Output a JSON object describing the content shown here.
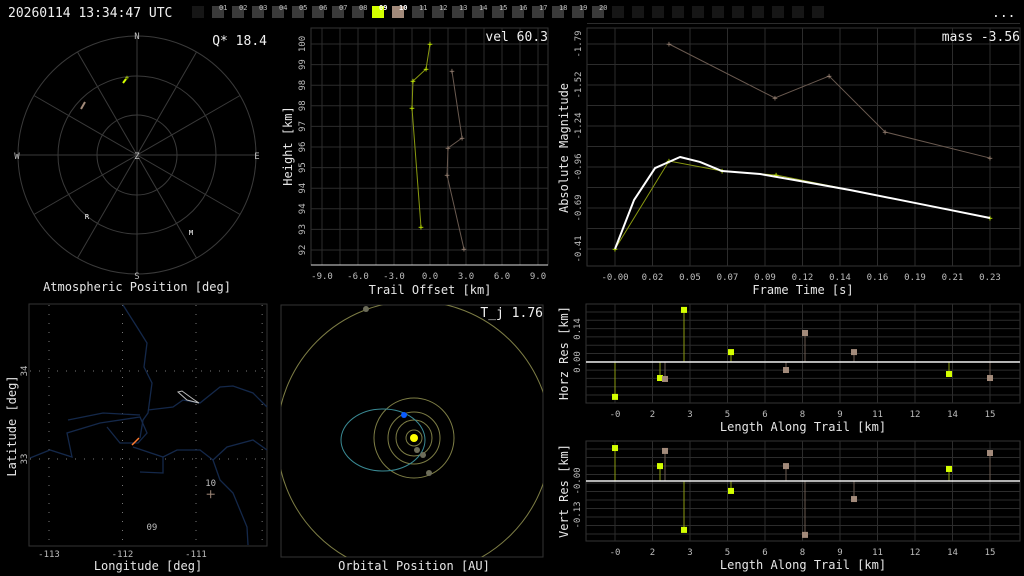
{
  "header": {
    "timestamp": "20260114 13:34:47 UTC",
    "menu_label": "...",
    "frames": [
      {
        "label": "01",
        "state": "normal"
      },
      {
        "label": "02",
        "state": "normal"
      },
      {
        "label": "03",
        "state": "normal"
      },
      {
        "label": "04",
        "state": "normal"
      },
      {
        "label": "05",
        "state": "normal"
      },
      {
        "label": "06",
        "state": "normal"
      },
      {
        "label": "07",
        "state": "normal"
      },
      {
        "label": "08",
        "state": "normal"
      },
      {
        "label": "09",
        "state": "active"
      },
      {
        "label": "10",
        "state": "selected"
      },
      {
        "label": "11",
        "state": "normal"
      },
      {
        "label": "12",
        "state": "normal"
      },
      {
        "label": "13",
        "state": "normal"
      },
      {
        "label": "14",
        "state": "normal"
      },
      {
        "label": "15",
        "state": "normal"
      },
      {
        "label": "16",
        "state": "normal"
      },
      {
        "label": "17",
        "state": "normal"
      },
      {
        "label": "18",
        "state": "normal"
      },
      {
        "label": "19",
        "state": "normal"
      },
      {
        "label": "20",
        "state": "normal"
      }
    ]
  },
  "colors": {
    "station_a": "#d4ff00",
    "station_b": "#a28a7a",
    "fit": "#ffffff",
    "grid": "#2c2c2c",
    "river": "#14284a",
    "orbit": "#7d7d45",
    "meteoroid_orbit": "#3a8a94",
    "meteoroid": "#0a5cff",
    "sun": "#ffff00"
  },
  "atmospheric": {
    "title": "Atmospheric Position [deg]",
    "metric": "Q* 18.4",
    "cardinals": {
      "n": "N",
      "s": "S",
      "e": "E",
      "w": "W",
      "z": "Z"
    },
    "markers": [
      {
        "label": "R"
      },
      {
        "label": "M"
      }
    ]
  },
  "map": {
    "xlabel": "Longitude [deg]",
    "ylabel": "Latitude [deg]",
    "xticks": [
      {
        "value": -113,
        "label": "-113"
      },
      {
        "value": -112,
        "label": "-112"
      },
      {
        "value": -111,
        "label": "-111"
      }
    ],
    "yticks": [
      {
        "value": 34,
        "label": "34"
      },
      {
        "value": 33,
        "label": "33"
      }
    ],
    "stations": [
      {
        "label": "10",
        "lon": -110.8,
        "lat": 32.6
      },
      {
        "label": "09",
        "lon": -111.6,
        "lat": 32.1
      }
    ]
  },
  "orbital": {
    "title": "Orbital Position [AU]",
    "metric": "T_j 1.76"
  },
  "chart_data": [
    {
      "id": "trail",
      "type": "line",
      "metric": "vel 60.3",
      "xlabel": "Trail Offset [km]",
      "ylabel": "Height [km]",
      "xlim": [
        -9.8,
        9.8
      ],
      "ylim": [
        91.2,
        100.6
      ],
      "xticks": [
        {
          "v": -9,
          "l": "-9.0"
        },
        {
          "v": -6,
          "l": "-6.0"
        },
        {
          "v": -3,
          "l": "-3.0"
        },
        {
          "v": 0,
          "l": "0.0"
        },
        {
          "v": 3,
          "l": "3.0"
        },
        {
          "v": 6,
          "l": "6.0"
        },
        {
          "v": 9,
          "l": "9.0"
        }
      ],
      "yticks": [
        {
          "v": 100,
          "l": "100"
        },
        {
          "v": 99.2,
          "l": "99"
        },
        {
          "v": 98.4,
          "l": "98"
        },
        {
          "v": 97.6,
          "l": "98"
        },
        {
          "v": 96.8,
          "l": "97"
        },
        {
          "v": 96.0,
          "l": "96"
        },
        {
          "v": 95.2,
          "l": "95"
        },
        {
          "v": 94.4,
          "l": "94"
        },
        {
          "v": 93.6,
          "l": "94"
        },
        {
          "v": 92.8,
          "l": "93"
        },
        {
          "v": 92.0,
          "l": "92"
        }
      ],
      "series": [
        {
          "station": "a",
          "x": [
            0.0,
            -0.33,
            -1.42,
            -1.5,
            -0.75
          ],
          "y": [
            100.0,
            99.03,
            98.56,
            97.51,
            92.89
          ]
        },
        {
          "station": "b",
          "x": [
            1.83,
            2.67,
            1.5,
            1.42,
            2.83
          ],
          "y": [
            98.95,
            96.35,
            95.96,
            94.91,
            92.04
          ]
        }
      ]
    },
    {
      "id": "magnitude",
      "type": "line",
      "metric": "mass -3.56",
      "xlabel": "Frame Time [s]",
      "ylabel": "Absolute Magnitude",
      "xticks": [
        {
          "v": 0,
          "l": "-0.00"
        },
        {
          "v": 0.0234,
          "l": "0.02"
        },
        {
          "v": 0.0468,
          "l": "0.05"
        },
        {
          "v": 0.0702,
          "l": "0.07"
        },
        {
          "v": 0.0936,
          "l": "0.09"
        },
        {
          "v": 0.117,
          "l": "0.12"
        },
        {
          "v": 0.1404,
          "l": "0.14"
        },
        {
          "v": 0.1638,
          "l": "0.16"
        },
        {
          "v": 0.1872,
          "l": "0.19"
        },
        {
          "v": 0.2106,
          "l": "0.21"
        },
        {
          "v": 0.234,
          "l": "0.23"
        }
      ],
      "yticks": [
        {
          "v": -1.79,
          "l": "-1.79"
        },
        {
          "v": -1.515,
          "l": "-1.52"
        },
        {
          "v": -1.24,
          "l": "-1.24"
        },
        {
          "v": -0.965,
          "l": "-0.96"
        },
        {
          "v": -0.69,
          "l": "-0.69"
        },
        {
          "v": -0.415,
          "l": "-0.41"
        }
      ],
      "yinverted": true,
      "series": [
        {
          "station": "a",
          "x": [
            0.0,
            0.0337,
            0.0668,
            0.1005,
            0.234
          ],
          "y": [
            -0.415,
            -1.005,
            -0.938,
            -0.911,
            -0.623
          ]
        },
        {
          "station": "b",
          "x": [
            0.0337,
            0.0998,
            0.1336,
            0.1685,
            0.234
          ],
          "y": [
            -1.79,
            -1.428,
            -1.575,
            -1.2,
            -1.025
          ]
        },
        {
          "station": "fit",
          "x": [
            0.0,
            0.0119,
            0.025,
            0.0406,
            0.053,
            0.0668,
            0.0905,
            0.1154,
            0.1466,
            0.1778,
            0.209,
            0.234
          ],
          "y": [
            -0.415,
            -0.744,
            -0.958,
            -1.032,
            -0.999,
            -0.938,
            -0.918,
            -0.871,
            -0.811,
            -0.744,
            -0.677,
            -0.623
          ]
        }
      ]
    },
    {
      "id": "horz_res",
      "type": "scatter",
      "xlabel": "Length Along Trail [km]",
      "ylabel": "Horz Res [km]",
      "xticks": [
        {
          "v": 0,
          "l": "-0"
        },
        {
          "v": 1.5,
          "l": "2"
        },
        {
          "v": 3,
          "l": "3"
        },
        {
          "v": 4.5,
          "l": "5"
        },
        {
          "v": 6,
          "l": "6"
        },
        {
          "v": 7.5,
          "l": "8"
        },
        {
          "v": 9,
          "l": "9"
        },
        {
          "v": 10.5,
          "l": "11"
        },
        {
          "v": 12,
          "l": "12"
        },
        {
          "v": 13.5,
          "l": "14"
        },
        {
          "v": 15,
          "l": "15"
        }
      ],
      "yticks": [
        {
          "v": 0.14,
          "l": "0.14"
        },
        {
          "v": 0.0,
          "l": "0.00"
        }
      ],
      "series": [
        {
          "station": "a",
          "x": [
            0,
            1.8,
            2.76,
            4.64,
            13.36
          ],
          "y": [
            -0.148,
            -0.068,
            0.221,
            0.042,
            -0.051
          ]
        },
        {
          "station": "b",
          "x": [
            2.0,
            6.84,
            7.6,
            9.56,
            15.0
          ],
          "y": [
            -0.072,
            -0.034,
            0.123,
            0.042,
            -0.068
          ]
        }
      ]
    },
    {
      "id": "vert_res",
      "type": "scatter",
      "xlabel": "Length Along Trail [km]",
      "ylabel": "Vert Res [km]",
      "xticks": [
        {
          "v": 0,
          "l": "-0"
        },
        {
          "v": 1.5,
          "l": "2"
        },
        {
          "v": 3,
          "l": "3"
        },
        {
          "v": 4.5,
          "l": "5"
        },
        {
          "v": 6,
          "l": "6"
        },
        {
          "v": 7.5,
          "l": "8"
        },
        {
          "v": 9,
          "l": "9"
        },
        {
          "v": 10.5,
          "l": "11"
        },
        {
          "v": 12,
          "l": "12"
        },
        {
          "v": 13.5,
          "l": "14"
        },
        {
          "v": 15,
          "l": "15"
        }
      ],
      "yticks": [
        {
          "v": 0.0,
          "l": "-0.00"
        },
        {
          "v": -0.13,
          "l": "-0.13"
        }
      ],
      "series": [
        {
          "station": "a",
          "x": [
            0,
            1.8,
            2.76,
            4.64,
            13.36
          ],
          "y": [
            0.126,
            0.057,
            -0.187,
            -0.038,
            0.046
          ]
        },
        {
          "station": "b",
          "x": [
            2.0,
            6.84,
            7.6,
            9.56,
            15.0
          ],
          "y": [
            0.115,
            0.057,
            -0.206,
            -0.069,
            0.107
          ]
        }
      ]
    }
  ]
}
